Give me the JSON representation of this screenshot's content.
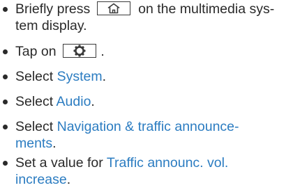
{
  "steps": [
    {
      "line1_before": "Briefly press",
      "icon": "home-icon",
      "line1_after": "on the multimedia sys-",
      "line2": "tem display."
    },
    {
      "before": "Tap on",
      "icon": "gear-icon",
      "after": "."
    },
    {
      "before": "Select",
      "link": "System",
      "after": "."
    },
    {
      "before": "Select",
      "link": "Audio",
      "after": "."
    },
    {
      "before": "Select",
      "link_line1": "Navigation & traffic announce-",
      "link_line2": "ments",
      "after": "."
    },
    {
      "before": "Set a value for",
      "link_line1": "Traffic announc. vol.",
      "link_line2": "increase",
      "after": "."
    }
  ],
  "colors": {
    "text": "#2a2a2a",
    "link": "#2b7cc1"
  }
}
